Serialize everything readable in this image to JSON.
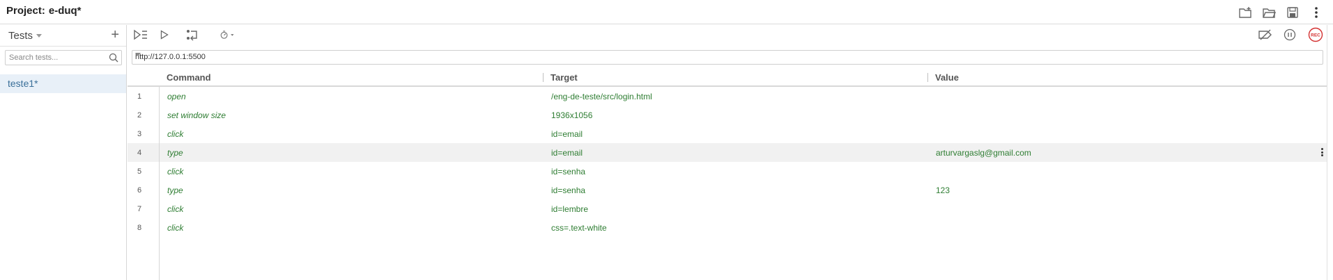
{
  "header": {
    "project_label": "Project:",
    "project_name": "e-duq*",
    "icons": [
      "new-project-icon",
      "open-folder-icon",
      "save-icon",
      "more-vert-icon"
    ]
  },
  "sidebar": {
    "title": "Tests",
    "add_label": "+",
    "search_placeholder": "Search tests...",
    "tests": [
      {
        "label": "teste1*",
        "selected": true
      }
    ]
  },
  "toolbar": {
    "icons": [
      "run-all-icon",
      "run-current-icon",
      "step-icon",
      "speed-icon",
      "disable-breakpoints-icon",
      "pause-icon",
      "record-icon"
    ],
    "record_label": "REC"
  },
  "url": {
    "value": "http://127.0.0.1:5500"
  },
  "table": {
    "headers": {
      "command": "Command",
      "target": "Target",
      "value": "Value"
    },
    "rows": [
      {
        "n": "1",
        "command": "open",
        "target": "/eng-de-teste/src/login.html",
        "value": ""
      },
      {
        "n": "2",
        "command": "set window size",
        "target": "1936x1056",
        "value": ""
      },
      {
        "n": "3",
        "command": "click",
        "target": "id=email",
        "value": ""
      },
      {
        "n": "4",
        "command": "type",
        "target": "id=email",
        "value": "arturvargaslg@gmail.com"
      },
      {
        "n": "5",
        "command": "click",
        "target": "id=senha",
        "value": ""
      },
      {
        "n": "6",
        "command": "type",
        "target": "id=senha",
        "value": "123"
      },
      {
        "n": "7",
        "command": "click",
        "target": "id=lembre",
        "value": ""
      },
      {
        "n": "8",
        "command": "click",
        "target": "css=.text-white",
        "value": ""
      }
    ]
  },
  "colors": {
    "command_text": "#2e7d32",
    "selected_test_bg": "#e8f0f8",
    "record_red": "#d32f2f"
  }
}
